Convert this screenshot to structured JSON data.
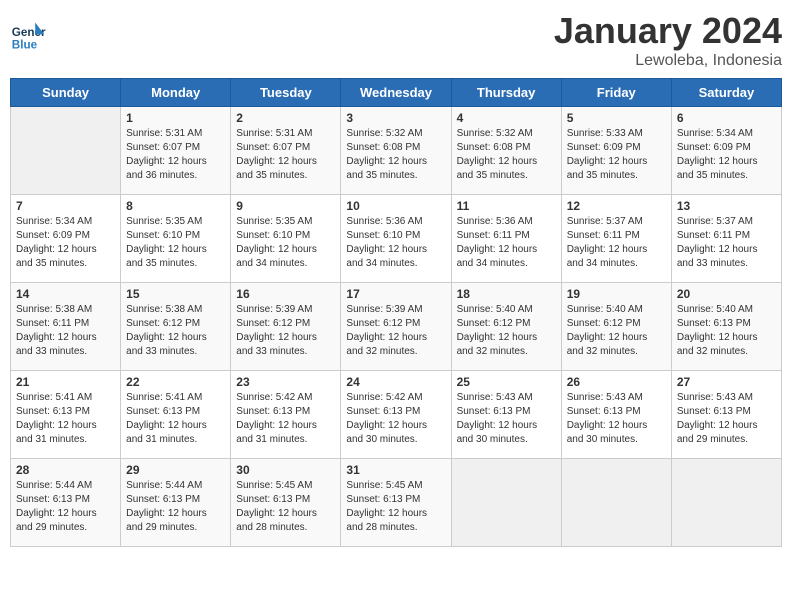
{
  "logo": {
    "line1": "General",
    "line2": "Blue"
  },
  "title": "January 2024",
  "subtitle": "Lewoleba, Indonesia",
  "headers": [
    "Sunday",
    "Monday",
    "Tuesday",
    "Wednesday",
    "Thursday",
    "Friday",
    "Saturday"
  ],
  "weeks": [
    [
      {
        "num": "",
        "info": ""
      },
      {
        "num": "1",
        "info": "Sunrise: 5:31 AM\nSunset: 6:07 PM\nDaylight: 12 hours\nand 36 minutes."
      },
      {
        "num": "2",
        "info": "Sunrise: 5:31 AM\nSunset: 6:07 PM\nDaylight: 12 hours\nand 35 minutes."
      },
      {
        "num": "3",
        "info": "Sunrise: 5:32 AM\nSunset: 6:08 PM\nDaylight: 12 hours\nand 35 minutes."
      },
      {
        "num": "4",
        "info": "Sunrise: 5:32 AM\nSunset: 6:08 PM\nDaylight: 12 hours\nand 35 minutes."
      },
      {
        "num": "5",
        "info": "Sunrise: 5:33 AM\nSunset: 6:09 PM\nDaylight: 12 hours\nand 35 minutes."
      },
      {
        "num": "6",
        "info": "Sunrise: 5:34 AM\nSunset: 6:09 PM\nDaylight: 12 hours\nand 35 minutes."
      }
    ],
    [
      {
        "num": "7",
        "info": "Sunrise: 5:34 AM\nSunset: 6:09 PM\nDaylight: 12 hours\nand 35 minutes."
      },
      {
        "num": "8",
        "info": "Sunrise: 5:35 AM\nSunset: 6:10 PM\nDaylight: 12 hours\nand 35 minutes."
      },
      {
        "num": "9",
        "info": "Sunrise: 5:35 AM\nSunset: 6:10 PM\nDaylight: 12 hours\nand 34 minutes."
      },
      {
        "num": "10",
        "info": "Sunrise: 5:36 AM\nSunset: 6:10 PM\nDaylight: 12 hours\nand 34 minutes."
      },
      {
        "num": "11",
        "info": "Sunrise: 5:36 AM\nSunset: 6:11 PM\nDaylight: 12 hours\nand 34 minutes."
      },
      {
        "num": "12",
        "info": "Sunrise: 5:37 AM\nSunset: 6:11 PM\nDaylight: 12 hours\nand 34 minutes."
      },
      {
        "num": "13",
        "info": "Sunrise: 5:37 AM\nSunset: 6:11 PM\nDaylight: 12 hours\nand 33 minutes."
      }
    ],
    [
      {
        "num": "14",
        "info": "Sunrise: 5:38 AM\nSunset: 6:11 PM\nDaylight: 12 hours\nand 33 minutes."
      },
      {
        "num": "15",
        "info": "Sunrise: 5:38 AM\nSunset: 6:12 PM\nDaylight: 12 hours\nand 33 minutes."
      },
      {
        "num": "16",
        "info": "Sunrise: 5:39 AM\nSunset: 6:12 PM\nDaylight: 12 hours\nand 33 minutes."
      },
      {
        "num": "17",
        "info": "Sunrise: 5:39 AM\nSunset: 6:12 PM\nDaylight: 12 hours\nand 32 minutes."
      },
      {
        "num": "18",
        "info": "Sunrise: 5:40 AM\nSunset: 6:12 PM\nDaylight: 12 hours\nand 32 minutes."
      },
      {
        "num": "19",
        "info": "Sunrise: 5:40 AM\nSunset: 6:12 PM\nDaylight: 12 hours\nand 32 minutes."
      },
      {
        "num": "20",
        "info": "Sunrise: 5:40 AM\nSunset: 6:13 PM\nDaylight: 12 hours\nand 32 minutes."
      }
    ],
    [
      {
        "num": "21",
        "info": "Sunrise: 5:41 AM\nSunset: 6:13 PM\nDaylight: 12 hours\nand 31 minutes."
      },
      {
        "num": "22",
        "info": "Sunrise: 5:41 AM\nSunset: 6:13 PM\nDaylight: 12 hours\nand 31 minutes."
      },
      {
        "num": "23",
        "info": "Sunrise: 5:42 AM\nSunset: 6:13 PM\nDaylight: 12 hours\nand 31 minutes."
      },
      {
        "num": "24",
        "info": "Sunrise: 5:42 AM\nSunset: 6:13 PM\nDaylight: 12 hours\nand 30 minutes."
      },
      {
        "num": "25",
        "info": "Sunrise: 5:43 AM\nSunset: 6:13 PM\nDaylight: 12 hours\nand 30 minutes."
      },
      {
        "num": "26",
        "info": "Sunrise: 5:43 AM\nSunset: 6:13 PM\nDaylight: 12 hours\nand 30 minutes."
      },
      {
        "num": "27",
        "info": "Sunrise: 5:43 AM\nSunset: 6:13 PM\nDaylight: 12 hours\nand 29 minutes."
      }
    ],
    [
      {
        "num": "28",
        "info": "Sunrise: 5:44 AM\nSunset: 6:13 PM\nDaylight: 12 hours\nand 29 minutes."
      },
      {
        "num": "29",
        "info": "Sunrise: 5:44 AM\nSunset: 6:13 PM\nDaylight: 12 hours\nand 29 minutes."
      },
      {
        "num": "30",
        "info": "Sunrise: 5:45 AM\nSunset: 6:13 PM\nDaylight: 12 hours\nand 28 minutes."
      },
      {
        "num": "31",
        "info": "Sunrise: 5:45 AM\nSunset: 6:13 PM\nDaylight: 12 hours\nand 28 minutes."
      },
      {
        "num": "",
        "info": ""
      },
      {
        "num": "",
        "info": ""
      },
      {
        "num": "",
        "info": ""
      }
    ]
  ]
}
